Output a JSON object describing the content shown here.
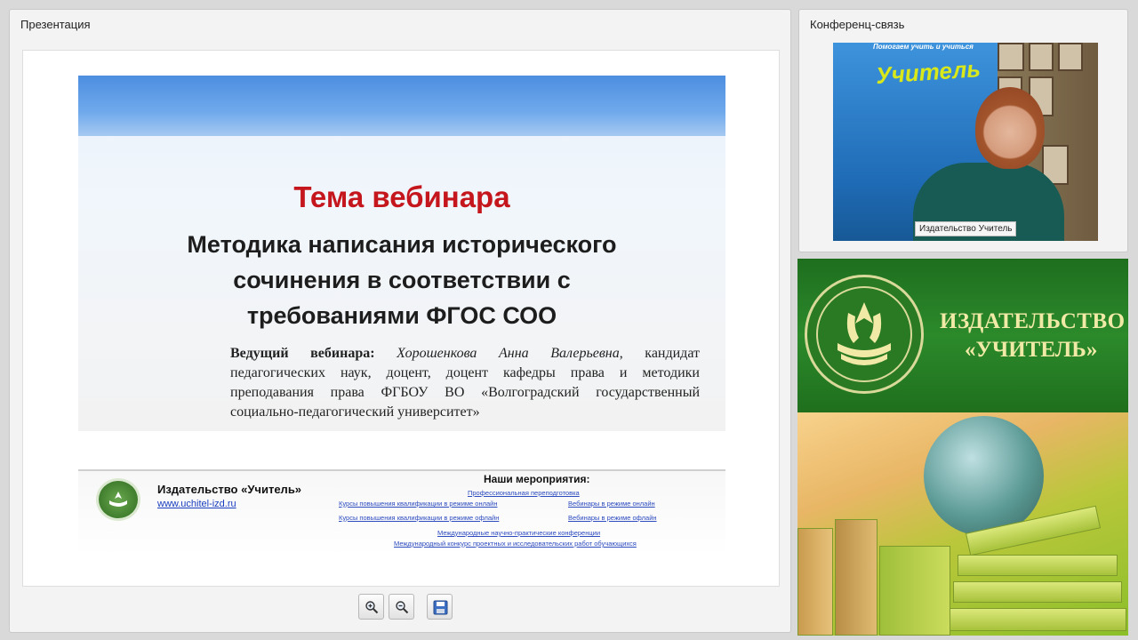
{
  "presentation_panel": {
    "title": "Презентация"
  },
  "slide": {
    "topic": "Тема вебинара",
    "title_line1": "Методика написания исторического",
    "title_line2": "сочинения в соответствии с",
    "title_line3": "требованиями ФГОС СОО",
    "presenter_label": "Ведущий вебинара:",
    "presenter_name": "Хорошенкова Анна Валерьевна",
    "presenter_info": ", кандидат педагогических наук, доцент, доцент кафедры права и методики преподавания права ФГБОУ ВО «Волгоградский государственный социально-педагогический университет»"
  },
  "footer": {
    "publisher": "Издательство «Учитель»",
    "url": "www.uchitel-izd.ru",
    "events_title": "Наши мероприятия:",
    "events": [
      "Профессиональная переподготовка",
      "Курсы повышения квалификации в режиме онлайн",
      "Вебинары в режиме онлайн",
      "Курсы повышения квалификации в режиме офлайн",
      "Вебинары в режиме офлайн",
      "Международные научно-практические конференции",
      "Международный конкурс проектных и исследовательских работ обучающихся"
    ]
  },
  "toolbar": {
    "zoom_in": "zoom-in-icon",
    "zoom_out": "zoom-out-icon",
    "save": "save-icon"
  },
  "conference_panel": {
    "title": "Конференц-связь",
    "video_label": "Издательство Учитель",
    "banner_top": "Помогаем учить и учиться",
    "banner_brand": "Учитель"
  },
  "ad": {
    "line1": "ИЗДАТЕЛЬСТВО",
    "line2": "«УЧИТЕЛЬ»"
  }
}
